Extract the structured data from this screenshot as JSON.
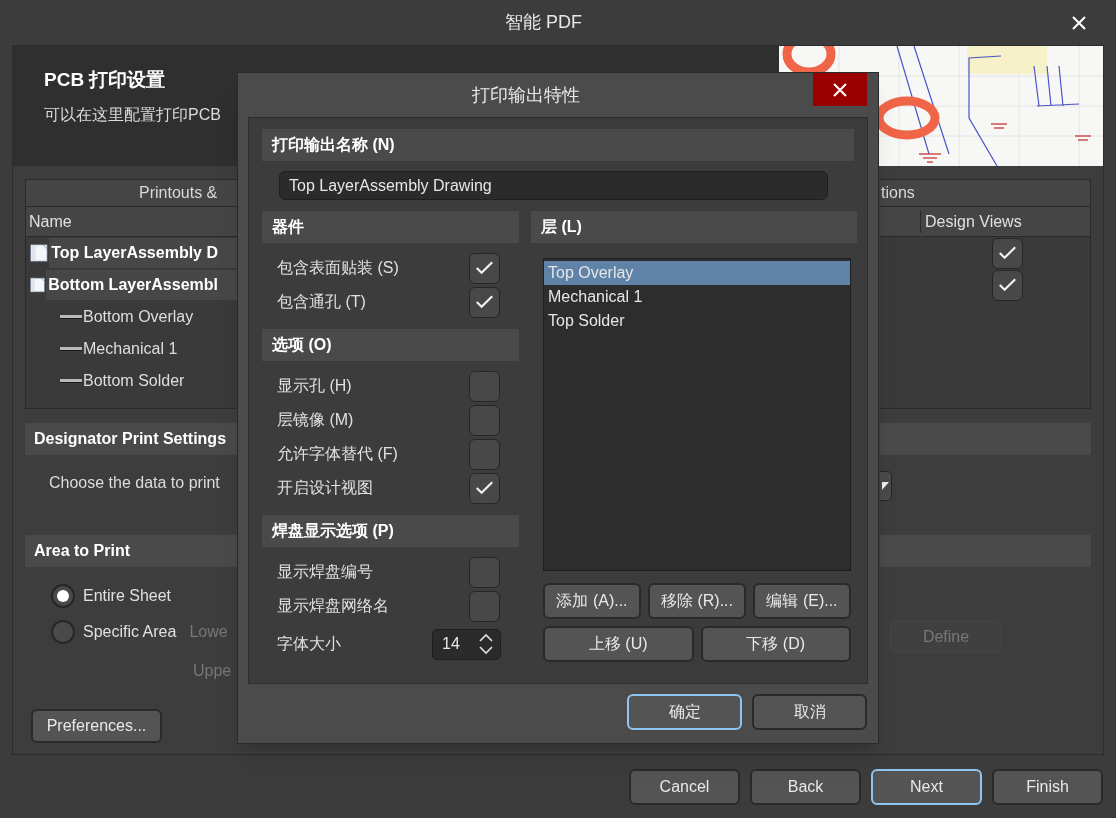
{
  "window": {
    "title": "智能 PDF"
  },
  "header": {
    "title": "PCB 打印设置",
    "subtitle": "可以在这里配置打印PCB"
  },
  "printouts": {
    "group_left": "Printouts &",
    "group_right": "tions",
    "columns": [
      "Name",
      "Design Views"
    ],
    "rows": [
      {
        "name": "Top LayerAssembly D",
        "design_views": true
      },
      {
        "name": "Bottom LayerAssembl",
        "design_views": true,
        "children": [
          {
            "name": "Bottom Overlay"
          },
          {
            "name": "Mechanical 1"
          },
          {
            "name": "Bottom Solder"
          }
        ]
      }
    ]
  },
  "designator": {
    "title": "Designator Print Settings",
    "prompt": "Choose the data to print"
  },
  "area": {
    "title": "Area to Print",
    "options": [
      {
        "label": "Entire Sheet",
        "selected": true
      },
      {
        "label": "Specific Area",
        "selected": false
      }
    ],
    "lower": "Lowe",
    "upper": "Uppe",
    "define": {
      "label": "Define",
      "disabled": true
    }
  },
  "preferences_button": "Preferences...",
  "wizard_buttons": [
    {
      "label": "Cancel",
      "focused": false
    },
    {
      "label": "Back",
      "focused": false
    },
    {
      "label": "Next",
      "focused": true
    },
    {
      "label": "Finish",
      "focused": false
    }
  ],
  "dialog": {
    "title": "打印输出特性",
    "name_section": {
      "title": "打印输出名称 (N)",
      "value": "Top LayerAssembly Drawing"
    },
    "option_sections": [
      {
        "title": "器件",
        "items": [
          {
            "label": "包含表面贴装 (S)",
            "kind": "checkbox",
            "checked": true
          },
          {
            "label": "包含通孔 (T)",
            "kind": "checkbox",
            "checked": true
          }
        ]
      },
      {
        "title": "选项 (O)",
        "items": [
          {
            "label": "显示孔 (H)",
            "kind": "checkbox",
            "checked": false
          },
          {
            "label": "层镜像 (M)",
            "kind": "checkbox",
            "checked": false
          },
          {
            "label": "允许字体替代 (F)",
            "kind": "checkbox",
            "checked": false
          },
          {
            "label": "开启设计视图",
            "kind": "checkbox",
            "checked": true
          }
        ]
      },
      {
        "title": "焊盘显示选项 (P)",
        "items": [
          {
            "label": "显示焊盘编号",
            "kind": "checkbox",
            "checked": false
          },
          {
            "label": "显示焊盘网络名",
            "kind": "checkbox",
            "checked": false
          },
          {
            "label": "字体大小",
            "kind": "spinner",
            "value": "14"
          }
        ]
      }
    ],
    "layers": {
      "title": "层 (L)",
      "items": [
        {
          "label": "Top Overlay",
          "selected": true
        },
        {
          "label": "Mechanical 1",
          "selected": false
        },
        {
          "label": "Top Solder",
          "selected": false
        }
      ],
      "button_rows": [
        [
          "添加 (A)...",
          "移除 (R)...",
          "编辑 (E)..."
        ],
        [
          "上移 (U)",
          "下移 (D)"
        ]
      ]
    },
    "buttons": [
      {
        "label": "确定",
        "focused": true
      },
      {
        "label": "取消",
        "focused": false
      }
    ]
  }
}
